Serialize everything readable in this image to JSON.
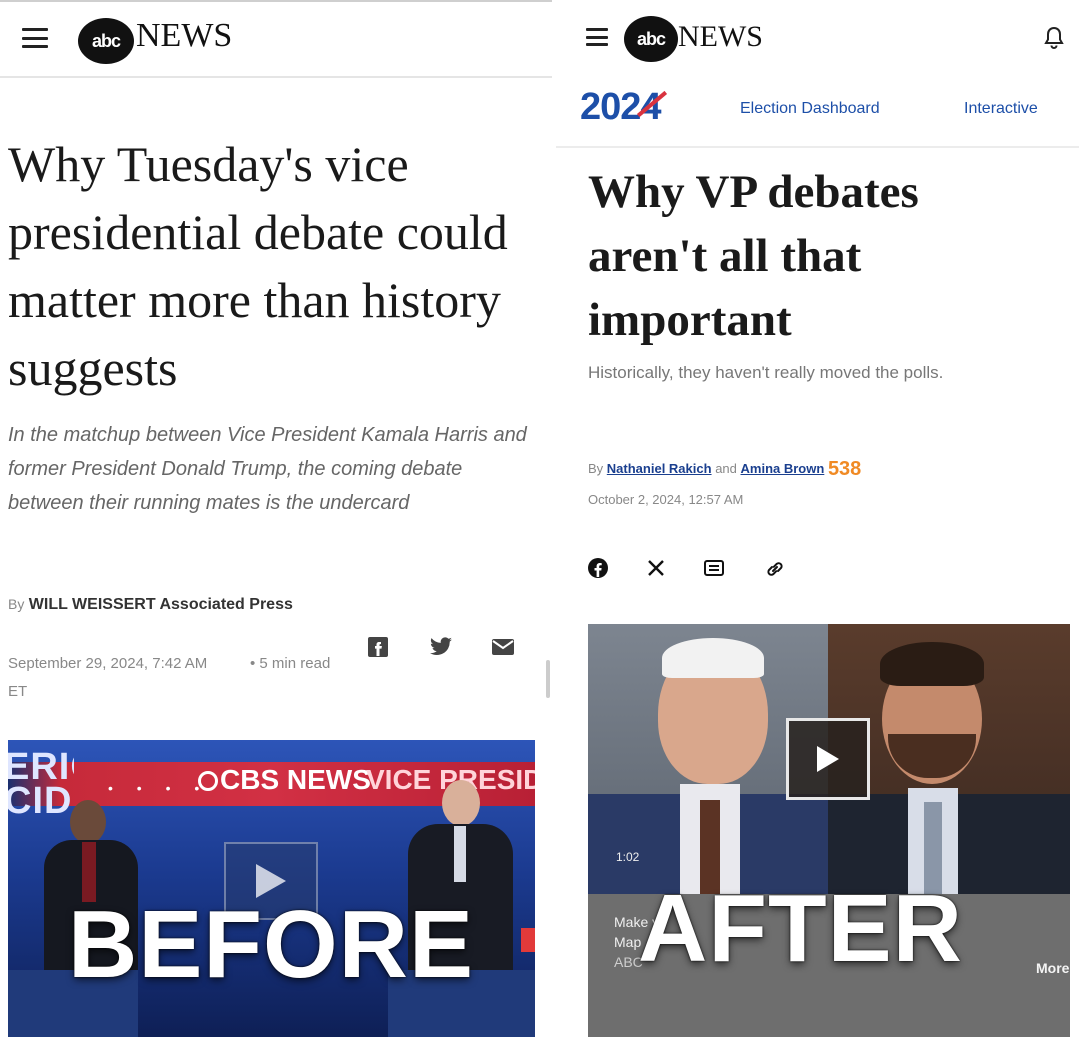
{
  "left": {
    "header": {
      "logo_text": "abc",
      "news_word": "NEWS"
    },
    "headline": "Why Tuesday's vice presidential debate could matter more than history suggests",
    "dek": "In the matchup between Vice President Kamala Harris and former President Donald Trump, the coming debate between their running mates is the undercard",
    "byline_prefix": "By",
    "byline_author": "WILL WEISSERT Associated Press",
    "date": "September 29, 2024, 7:42 AM ET",
    "read_time": "• 5 min read",
    "share_icons": [
      "facebook-icon",
      "twitter-icon",
      "email-icon"
    ],
    "photo": {
      "banner_left": "ERICA CID",
      "banner_brand": "CBS NEWS",
      "banner_right": "VICE PRESIDENT",
      "overlay": "BEFORE"
    }
  },
  "right": {
    "header": {
      "logo_text": "abc",
      "news_word": "NEWS"
    },
    "election_logo": "2024",
    "nav": [
      "Election Dashboard",
      "Interactive"
    ],
    "headline": "Why VP debates aren't all that important",
    "dek": "Historically, they haven't really moved the polls.",
    "byline_prefix": "By",
    "author1": "Nathaniel Rakich",
    "and": "and",
    "author2": "Amina Brown",
    "badge": "538",
    "date": "October 2, 2024, 12:57 AM",
    "share_icons": [
      "facebook-icon",
      "x-icon",
      "email-icon",
      "link-icon"
    ],
    "video": {
      "duration": "1:02",
      "caption_line1": "Make y",
      "caption_line2": "Map",
      "caption_source": "ABC",
      "more": "More",
      "overlay": "AFTER"
    }
  },
  "colors": {
    "abc_black": "#111111",
    "link_blue": "#1a3f8f",
    "election_blue": "#1d4fa8",
    "election_red": "#d9333f",
    "badge_orange": "#f08a24"
  }
}
